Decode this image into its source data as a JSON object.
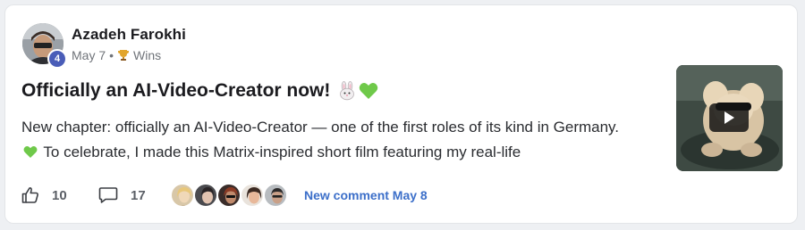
{
  "post": {
    "author": "Azadeh Farokhi",
    "level": "4",
    "date": "May 7",
    "separator": "•",
    "category": "Wins",
    "title": "Officially an AI-Video-Creator now!",
    "body_part1": "New chapter: officially an AI-Video-Creator — one of the first roles of its kind in Germany.",
    "body_part2": "To celebrate, I made this Matrix-inspired short film featuring my real-life",
    "likes": "10",
    "comments": "17",
    "new_comment": "New comment May 8"
  },
  "icons": {
    "trophy": "trophy-icon",
    "like": "thumbs-up-icon",
    "comment": "comment-icon",
    "play": "play-icon"
  },
  "colors": {
    "accent": "#3c6fc9",
    "badge": "#4a5db8",
    "heart": "#6fc94a"
  }
}
